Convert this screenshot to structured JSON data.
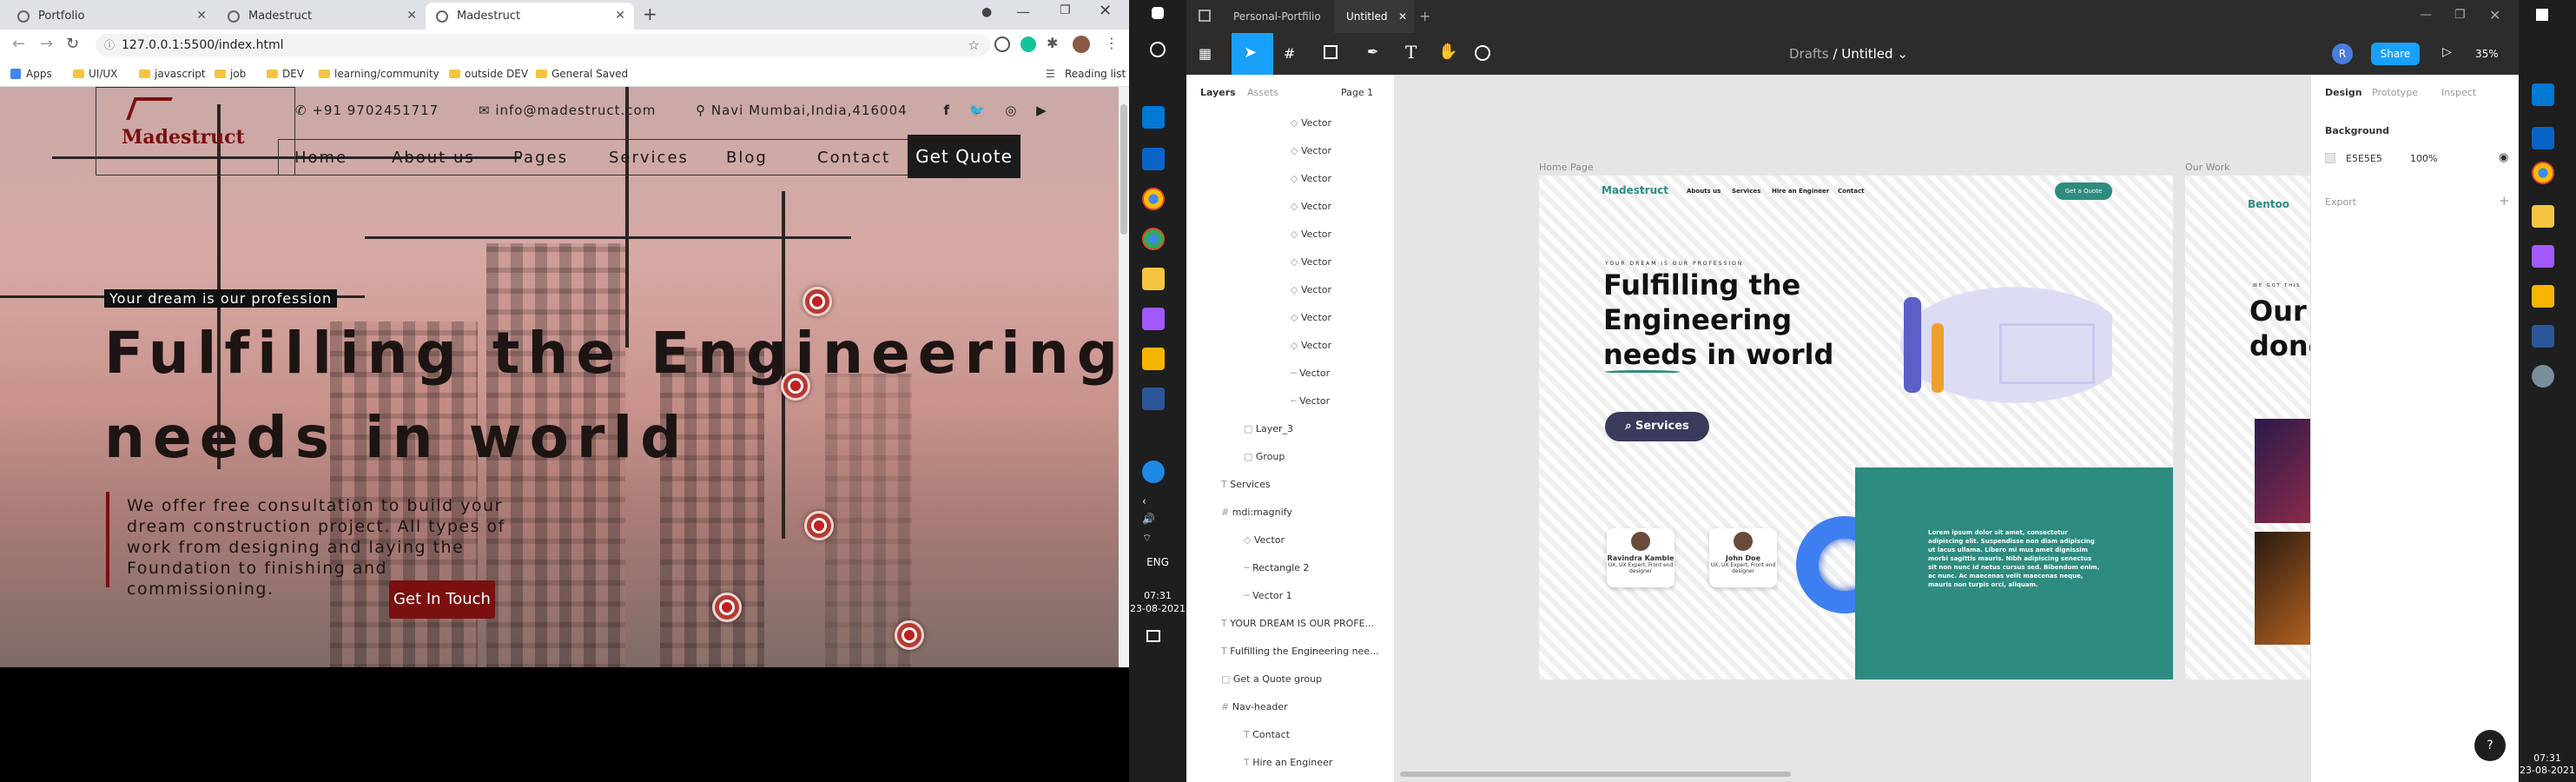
{
  "browser": {
    "tabs": [
      {
        "label": "Portfolio"
      },
      {
        "label": "Madestruct"
      },
      {
        "label": "Madestruct"
      }
    ],
    "url": "127.0.0.1:5500/index.html",
    "reading_list": "Reading list",
    "bookmarks": [
      "Apps",
      "UI/UX",
      "javascript",
      "job",
      "DEV",
      "learning/community",
      "outside DEV",
      "General Saved"
    ]
  },
  "site": {
    "logo": "Madestruct",
    "phone": "+91 9702451717",
    "email": "info@madestruct.com",
    "location": "Navi Mumbai,India,416004",
    "nav": [
      "Home",
      "About us",
      "Pages",
      "Services",
      "Blog",
      "Contact"
    ],
    "quote_button": "Get Quote",
    "tagline": "Your dream is our profession",
    "headline_line1": "Fulfilling the Engineering",
    "headline_line2": "needs in world",
    "paragraph": "We offer free consultation to build your dream construction project. All types of work from designing and laying the Foundation to finishing and commissioning.",
    "cta": "Get In Touch"
  },
  "taskbar": {
    "lang": "ENG",
    "time": "07:31",
    "date": "23-08-2021"
  },
  "figma": {
    "tabs": [
      "Personal-Portfilio",
      "Untitled"
    ],
    "breadcrumb_parent": "Drafts",
    "breadcrumb_file": "Untitled",
    "share": "Share",
    "avatar": "R",
    "zoom": "35%",
    "panel_tabs": [
      "Layers",
      "Assets"
    ],
    "page": "Page 1",
    "layers": [
      "Vector",
      "Vector",
      "Vector",
      "Vector",
      "Vector",
      "Vector",
      "Vector",
      "Vector",
      "Vector",
      "Vector",
      "Vector",
      "Layer_3",
      "Group",
      "Services",
      "mdi:magnify",
      "Vector",
      "Rectangle 2",
      "Vector 1",
      "YOUR DREAM IS OUR PROFE...",
      "Fulfilling the Engineering nee...",
      "Get a Quote group",
      "Nav-header",
      "Contact",
      "Hire an Engineer"
    ],
    "frames": {
      "home_label": "Home Page",
      "work_label": "Our Work",
      "home_logo": "Madestruct",
      "home_nav": [
        "Abouts us",
        "Services",
        "Hire an Engineer",
        "Contact"
      ],
      "home_quote": "Get a Quote",
      "home_tagline": "YOUR DREAM IS OUR PROFESSION",
      "home_headline": [
        "Fulfilling the",
        "Engineering",
        "needs in world"
      ],
      "home_services": "Services",
      "card1_name": "Ravindra Kamble",
      "card1_role": "UX, UX Expert, Front end designer",
      "card2_name": "John Doe",
      "card2_role": "UX, UX Expert, Front end designer",
      "lorem": "Lorem ipsum dolor sit amet, consectetur adipiscing elit. Suspendisse non diam adipiscing ut lacus ullama. Libero mi mus amet dignissim morbi sagittis mauris. Nibh adipiscing senectus sit non nunc id netus cursus sed. Bibendum enim, ac nunc. Ac maecenas velit maecenas neque, mauris non turpis orci, aliquam.",
      "work_logo": "Bentoo",
      "work_small": "WE GOT THIS",
      "work_heading": [
        "Our w",
        "done"
      ]
    },
    "right_tabs": [
      "Design",
      "Prototype",
      "Inspect"
    ],
    "background_label": "Background",
    "background_hex": "E5E5E5",
    "background_opacity": "100%",
    "export_label": "Export",
    "help": "?"
  },
  "colors": {
    "figma_blue": "#18a0fb",
    "teal": "#2e8b7f",
    "brand_red": "#7a1010"
  }
}
